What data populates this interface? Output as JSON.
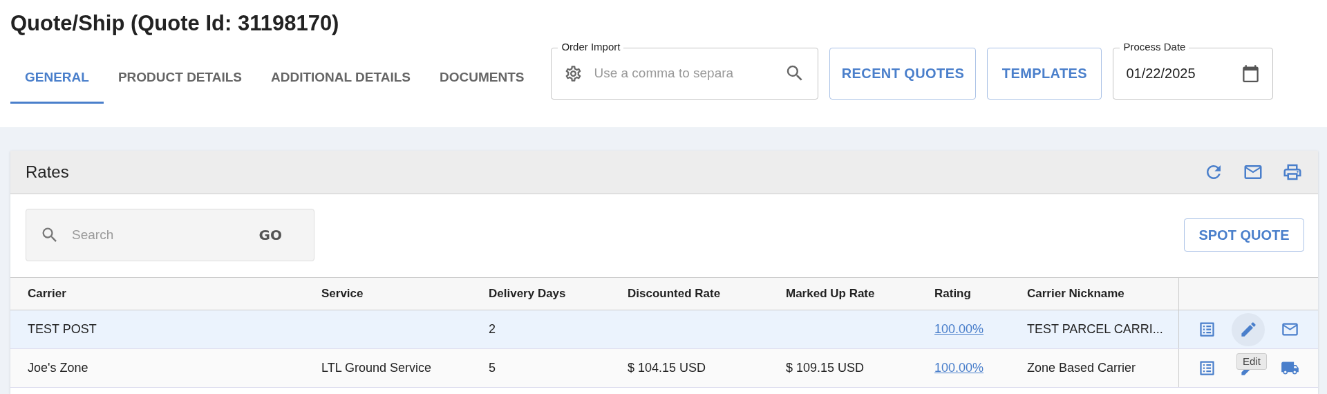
{
  "title": "Quote/Ship (Quote Id: 31198170)",
  "tabs": [
    {
      "label": "GENERAL",
      "selected": true
    },
    {
      "label": "PRODUCT DETAILS",
      "selected": false
    },
    {
      "label": "ADDITIONAL DETAILS",
      "selected": false
    },
    {
      "label": "DOCUMENTS",
      "selected": false
    }
  ],
  "order_import": {
    "label": "Order Import",
    "placeholder": "Use a comma to separa"
  },
  "buttons": [
    "RECENT QUOTES",
    "TEMPLATES"
  ],
  "process_date": {
    "label": "Process Date",
    "value": "01/22/2025"
  },
  "rates": {
    "title": "Rates",
    "search": {
      "placeholder": "Search",
      "go": "GO"
    },
    "spot_quote": "SPOT QUOTE",
    "columns": [
      "Carrier",
      "Service",
      "Delivery Days",
      "Discounted Rate",
      "Marked Up Rate",
      "Rating",
      "Carrier Nickname"
    ],
    "rows": [
      {
        "carrier": "TEST POST",
        "service": "",
        "delivery_days": "2",
        "discounted_rate": "",
        "marked_up_rate": "",
        "rating": "100.00%",
        "nickname": "TEST PARCEL CARRI...",
        "selected": true,
        "actions": [
          {
            "kind": "details",
            "hovered": false
          },
          {
            "kind": "edit",
            "hovered": true
          },
          {
            "kind": "email",
            "hovered": false
          }
        ]
      },
      {
        "carrier": "Joe's Zone",
        "service": "LTL Ground Service",
        "delivery_days": "5",
        "discounted_rate": "$ 104.15 USD",
        "marked_up_rate": "$ 109.15 USD",
        "rating": "100.00%",
        "nickname": "Zone Based Carrier",
        "selected": false,
        "actions": [
          {
            "kind": "details",
            "hovered": false
          },
          {
            "kind": "edit",
            "hovered": false
          },
          {
            "kind": "ship",
            "hovered": false
          }
        ]
      }
    ]
  },
  "tooltip": {
    "text": "Edit"
  }
}
